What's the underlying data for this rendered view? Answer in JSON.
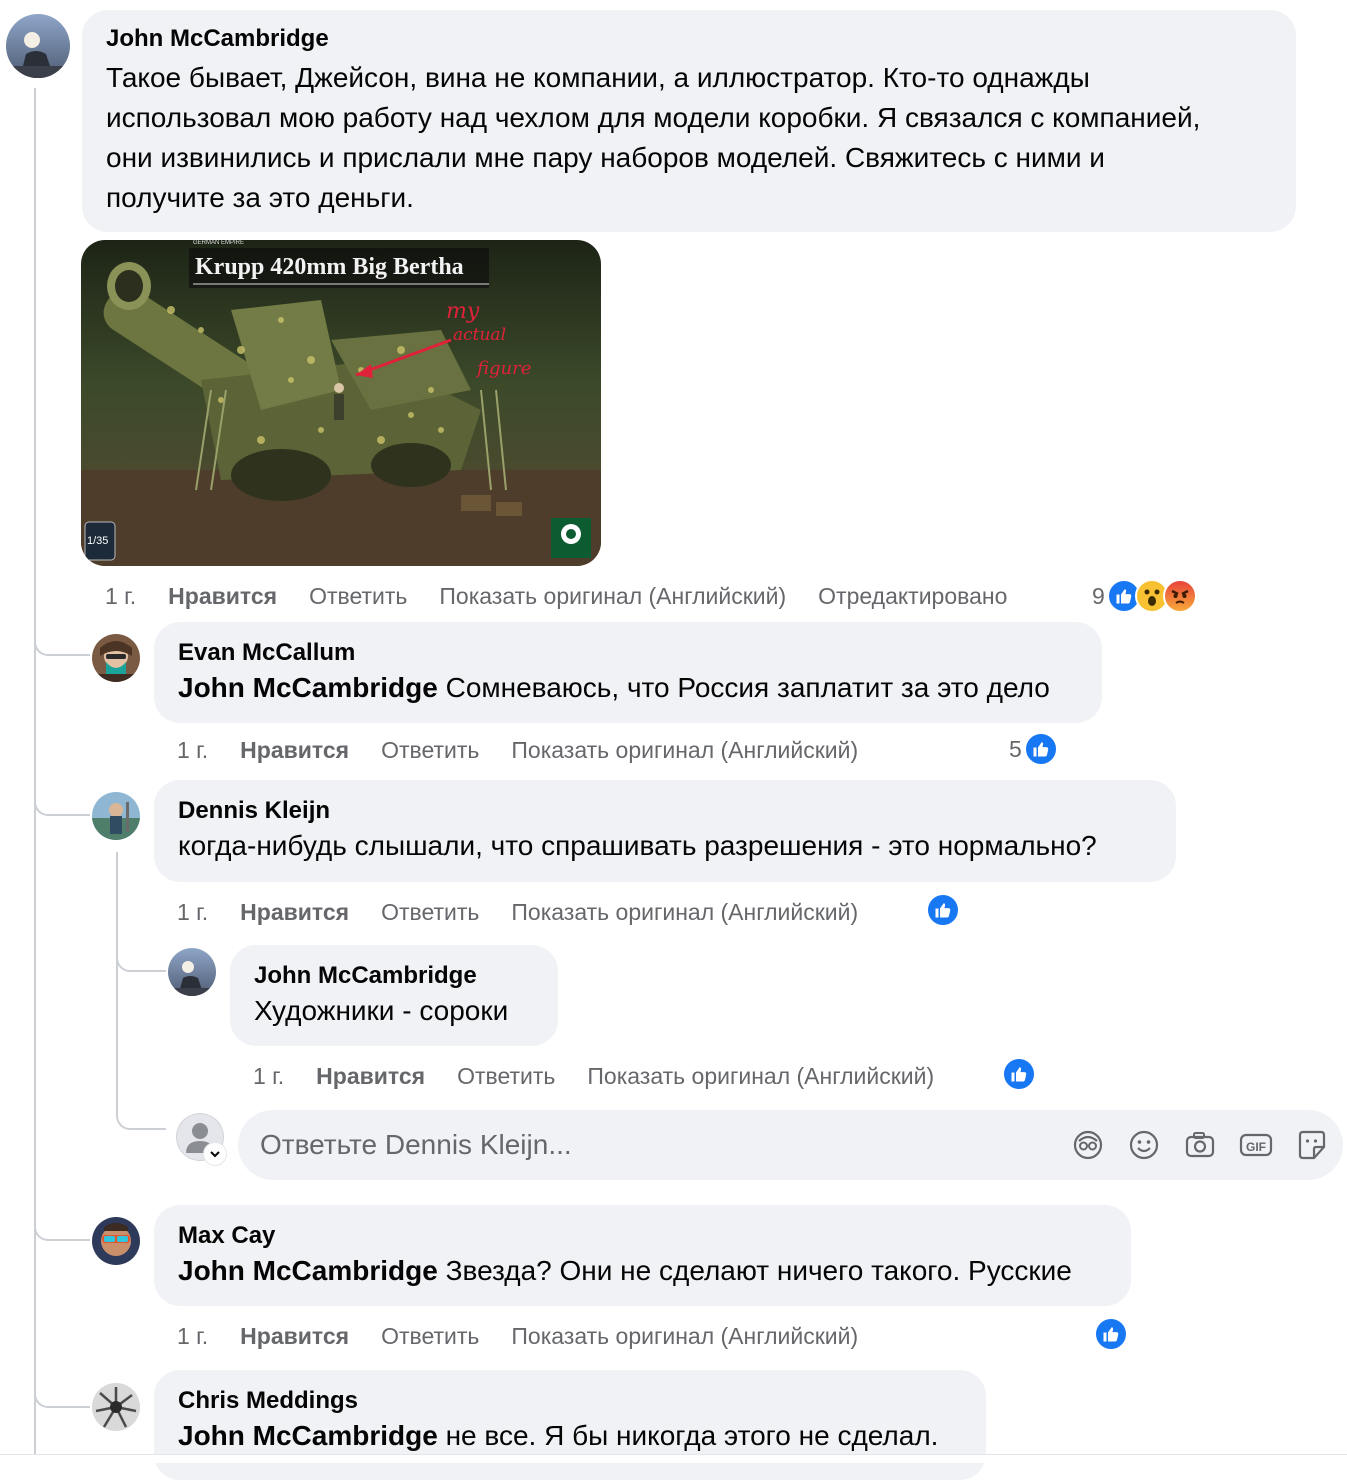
{
  "comments": {
    "main": {
      "author": "John McCambridge",
      "lines": [
        "Такое бывает, Джейсон, вина не компании, а иллюстратор. Кто-то однажды",
        "использовал мою работу над чехлом для модели коробки. Я связался с компанией,",
        "они извинились и прислали мне пару наборов моделей. Свяжитесь с ними и",
        "получите за это деньги."
      ],
      "image": {
        "title": "Krupp 420mm Big Bertha",
        "top_caption": "GERMAN EMPIRE",
        "scale": "1/35",
        "handwriting": [
          "my",
          "actual",
          "figure"
        ]
      },
      "time": "1 г.",
      "like": "Нравится",
      "reply": "Ответить",
      "original": "Показать оригинал (Английский)",
      "edited": "Отредактировано",
      "reaction_count": "9",
      "reactions": [
        "like",
        "wow",
        "angry"
      ]
    },
    "evan": {
      "author": "Evan McCallum",
      "mention": "John McCambridge",
      "text": " Сомневаюсь, что Россия заплатит за это дело",
      "time": "1 г.",
      "like": "Нравится",
      "reply": "Ответить",
      "original": "Показать оригинал (Английский)",
      "reaction_count": "5",
      "reactions": [
        "like"
      ]
    },
    "dennis": {
      "author": "Dennis Kleijn",
      "text": "когда-нибудь слышали, что спрашивать разрешения - это нормально?",
      "time": "1 г.",
      "like": "Нравится",
      "reply": "Ответить",
      "original": "Показать оригинал (Английский)",
      "reactions": [
        "like"
      ]
    },
    "john_reply": {
      "author": "John McCambridge",
      "text": "Художники - сороки",
      "time": "1 г.",
      "like": "Нравится",
      "reply": "Ответить",
      "original": "Показать оригинал (Английский)",
      "reactions": [
        "like"
      ]
    },
    "max": {
      "author": "Max Cay",
      "mention": "John McCambridge",
      "text": " Звезда? Они не сделают ничего такого. Русские",
      "time": "1 г.",
      "like": "Нравится",
      "reply": "Ответить",
      "original": "Показать оригинал (Английский)",
      "reactions": [
        "like"
      ]
    },
    "chris": {
      "author": "Chris Meddings",
      "mention": "John McCambridge",
      "text": " не все. Я бы никогда этого не сделал."
    }
  },
  "composer": {
    "placeholder": "Ответьте Dennis Kleijn...",
    "icons": [
      "avatar-sticker-icon",
      "emoji-icon",
      "camera-icon",
      "gif-icon",
      "sticker-icon"
    ],
    "gif_label": "GIF"
  },
  "colors": {
    "bubble": "#f0f2f5",
    "meta": "#65676b",
    "like_blue": "#1877f2",
    "thread_line": "#ccd0d5"
  }
}
